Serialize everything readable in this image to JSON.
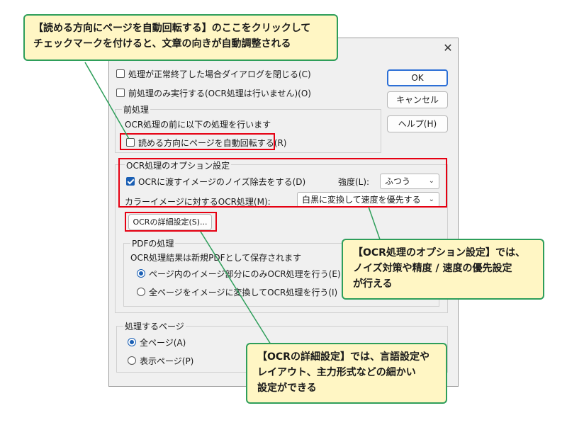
{
  "dialog": {
    "ok": "OK",
    "cancel": "キャンセル",
    "help": "ヘルプ(H)",
    "close_glyph": "✕",
    "close_dialog_label": "処理が正常終了した場合ダイアログを閉じる(C)",
    "preprocess_only_label": "前処理のみ実行する(OCR処理は行いません)(O)"
  },
  "preprocess": {
    "title": "前処理",
    "desc": "OCR処理の前に以下の処理を行います",
    "auto_rotate_label": "読める方向にページを自動回転する(R)",
    "auto_rotate_checked": false
  },
  "ocr_options": {
    "title": "OCR処理のオプション設定",
    "noise_label": "OCRに渡すイメージのノイズ除去をする(D)",
    "noise_checked": true,
    "strength_label": "強度(L):",
    "strength_value": "ふつう",
    "color_label": "カラーイメージに対するOCR処理(M):",
    "color_value": "白黒に変換して速度を優先する",
    "detail_button": "OCRの詳細設定(S)..."
  },
  "pdf": {
    "title": "PDFの処理",
    "desc": "OCR処理結果は新規PDFとして保存されます",
    "option1": "ページ内のイメージ部分にのみOCR処理を行う(E)",
    "option2": "全ページをイメージに変換してOCR処理を行う(I)",
    "selected": 1
  },
  "pages": {
    "title": "処理するページ",
    "all": "全ページ(A)",
    "visible": "表示ページ(P)",
    "selected": 1
  },
  "callouts": {
    "top_line1": "【読める方向にページを自動回転する】のここをクリックして",
    "top_line2": "チェックマークを付けると、文章の向きが自動調整される",
    "mid_line1": "【OCR処理のオプション設定】では、",
    "mid_line2": "ノイズ対策や精度 / 速度の優先設定",
    "mid_line3": "が行える",
    "bottom_line1": "【OCRの詳細設定】では、言語設定や",
    "bottom_line2": "レイアウト、主力形式などの細かい",
    "bottom_line3": "設定ができる"
  },
  "colors": {
    "highlight_red": "#e60012",
    "callout_border": "#2e9e5a",
    "callout_fill": "#fff6c4",
    "accent_blue": "#1a5fb4"
  }
}
